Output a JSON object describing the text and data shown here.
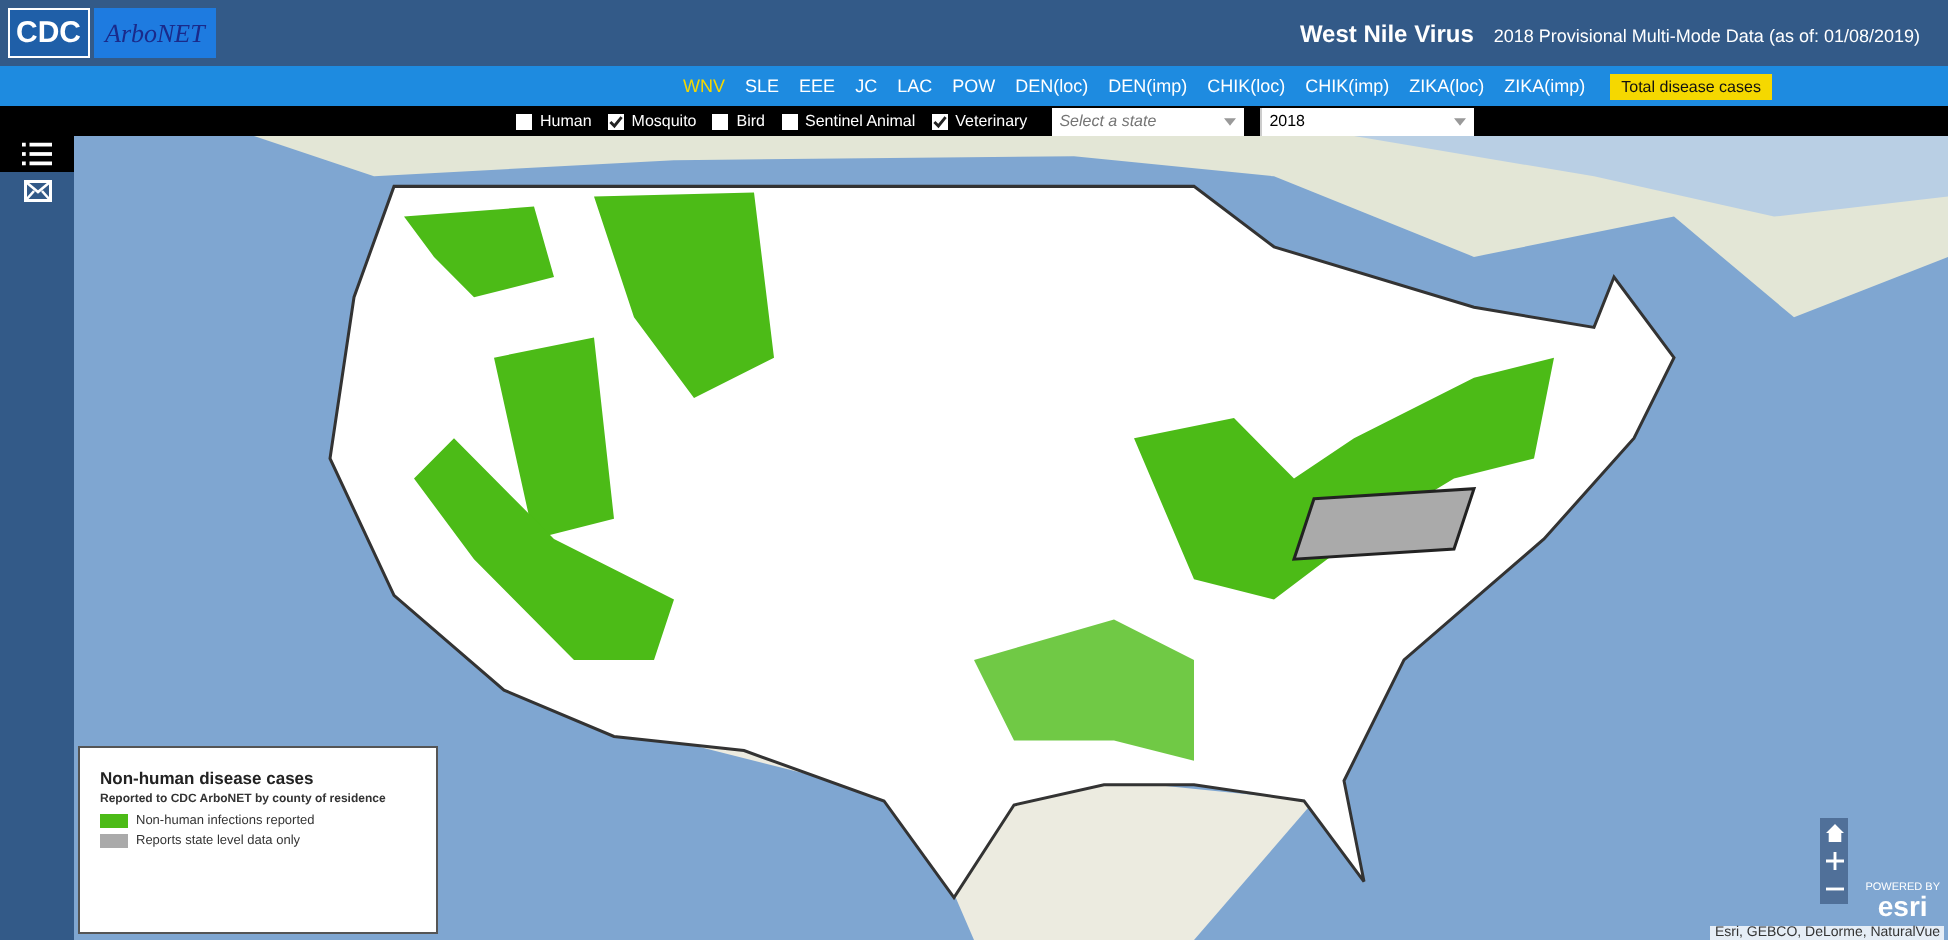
{
  "header": {
    "logo_text": "CDC",
    "logo_brand": "ArboNET",
    "title": "West Nile Virus",
    "subtitle": "2018 Provisional Multi-Mode Data (as of: 01/08/2019)"
  },
  "disease_tabs": [
    {
      "label": "WNV",
      "selected": true,
      "kind": "tab"
    },
    {
      "label": "SLE",
      "selected": false,
      "kind": "tab"
    },
    {
      "label": "EEE",
      "selected": false,
      "kind": "tab"
    },
    {
      "label": "JC",
      "selected": false,
      "kind": "tab"
    },
    {
      "label": "LAC",
      "selected": false,
      "kind": "tab"
    },
    {
      "label": "POW",
      "selected": false,
      "kind": "tab"
    },
    {
      "label": "DEN(loc)",
      "selected": false,
      "kind": "tab"
    },
    {
      "label": "DEN(imp)",
      "selected": false,
      "kind": "tab"
    },
    {
      "label": "CHIK(loc)",
      "selected": false,
      "kind": "tab"
    },
    {
      "label": "CHIK(imp)",
      "selected": false,
      "kind": "tab"
    },
    {
      "label": "ZIKA(loc)",
      "selected": false,
      "kind": "tab"
    },
    {
      "label": "ZIKA(imp)",
      "selected": false,
      "kind": "tab"
    },
    {
      "label": "Total disease cases",
      "selected": false,
      "kind": "button"
    }
  ],
  "filters": [
    {
      "label": "Human",
      "checked": false
    },
    {
      "label": "Mosquito",
      "checked": true
    },
    {
      "label": "Bird",
      "checked": false
    },
    {
      "label": "Sentinel Animal",
      "checked": false
    },
    {
      "label": "Veterinary",
      "checked": true
    }
  ],
  "state_select": {
    "placeholder": "Select a state"
  },
  "year_select": {
    "value": "2018"
  },
  "legend": {
    "title": "Non-human disease cases",
    "subtitle": "Reported to CDC ArboNET by county of residence",
    "items": [
      {
        "label": "Non-human infections reported",
        "color": "#4cbb17"
      },
      {
        "label": "Reports state level data only",
        "color": "#aaaaaa"
      }
    ]
  },
  "attribution": "Esri, GEBCO, DeLorme, NaturalVue",
  "esri_logo": {
    "caption": "POWERED BY",
    "text": "esri"
  }
}
